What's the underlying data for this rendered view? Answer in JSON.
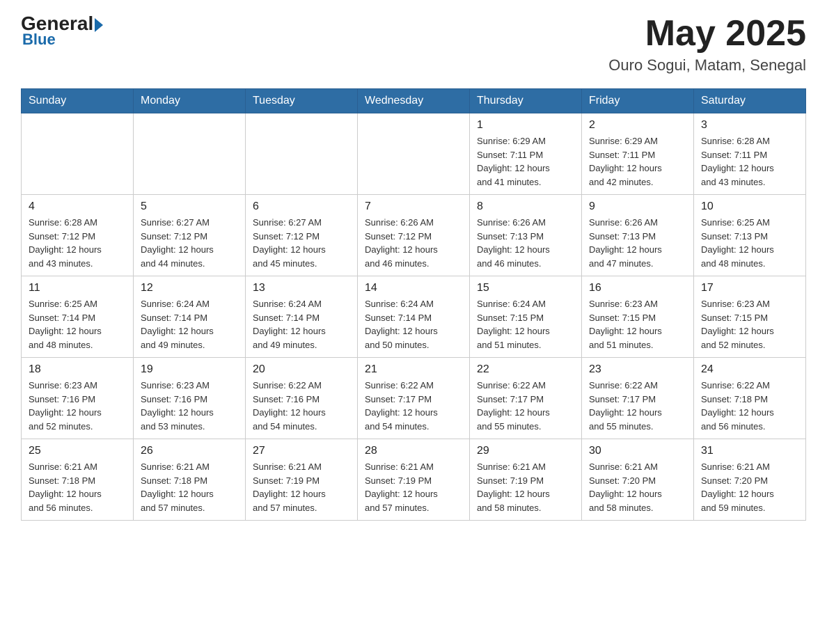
{
  "header": {
    "logo_general": "General",
    "logo_blue": "Blue",
    "month_year": "May 2025",
    "location": "Ouro Sogui, Matam, Senegal"
  },
  "days_of_week": [
    "Sunday",
    "Monday",
    "Tuesday",
    "Wednesday",
    "Thursday",
    "Friday",
    "Saturday"
  ],
  "weeks": [
    [
      {
        "day": "",
        "info": ""
      },
      {
        "day": "",
        "info": ""
      },
      {
        "day": "",
        "info": ""
      },
      {
        "day": "",
        "info": ""
      },
      {
        "day": "1",
        "info": "Sunrise: 6:29 AM\nSunset: 7:11 PM\nDaylight: 12 hours\nand 41 minutes."
      },
      {
        "day": "2",
        "info": "Sunrise: 6:29 AM\nSunset: 7:11 PM\nDaylight: 12 hours\nand 42 minutes."
      },
      {
        "day": "3",
        "info": "Sunrise: 6:28 AM\nSunset: 7:11 PM\nDaylight: 12 hours\nand 43 minutes."
      }
    ],
    [
      {
        "day": "4",
        "info": "Sunrise: 6:28 AM\nSunset: 7:12 PM\nDaylight: 12 hours\nand 43 minutes."
      },
      {
        "day": "5",
        "info": "Sunrise: 6:27 AM\nSunset: 7:12 PM\nDaylight: 12 hours\nand 44 minutes."
      },
      {
        "day": "6",
        "info": "Sunrise: 6:27 AM\nSunset: 7:12 PM\nDaylight: 12 hours\nand 45 minutes."
      },
      {
        "day": "7",
        "info": "Sunrise: 6:26 AM\nSunset: 7:12 PM\nDaylight: 12 hours\nand 46 minutes."
      },
      {
        "day": "8",
        "info": "Sunrise: 6:26 AM\nSunset: 7:13 PM\nDaylight: 12 hours\nand 46 minutes."
      },
      {
        "day": "9",
        "info": "Sunrise: 6:26 AM\nSunset: 7:13 PM\nDaylight: 12 hours\nand 47 minutes."
      },
      {
        "day": "10",
        "info": "Sunrise: 6:25 AM\nSunset: 7:13 PM\nDaylight: 12 hours\nand 48 minutes."
      }
    ],
    [
      {
        "day": "11",
        "info": "Sunrise: 6:25 AM\nSunset: 7:14 PM\nDaylight: 12 hours\nand 48 minutes."
      },
      {
        "day": "12",
        "info": "Sunrise: 6:24 AM\nSunset: 7:14 PM\nDaylight: 12 hours\nand 49 minutes."
      },
      {
        "day": "13",
        "info": "Sunrise: 6:24 AM\nSunset: 7:14 PM\nDaylight: 12 hours\nand 49 minutes."
      },
      {
        "day": "14",
        "info": "Sunrise: 6:24 AM\nSunset: 7:14 PM\nDaylight: 12 hours\nand 50 minutes."
      },
      {
        "day": "15",
        "info": "Sunrise: 6:24 AM\nSunset: 7:15 PM\nDaylight: 12 hours\nand 51 minutes."
      },
      {
        "day": "16",
        "info": "Sunrise: 6:23 AM\nSunset: 7:15 PM\nDaylight: 12 hours\nand 51 minutes."
      },
      {
        "day": "17",
        "info": "Sunrise: 6:23 AM\nSunset: 7:15 PM\nDaylight: 12 hours\nand 52 minutes."
      }
    ],
    [
      {
        "day": "18",
        "info": "Sunrise: 6:23 AM\nSunset: 7:16 PM\nDaylight: 12 hours\nand 52 minutes."
      },
      {
        "day": "19",
        "info": "Sunrise: 6:23 AM\nSunset: 7:16 PM\nDaylight: 12 hours\nand 53 minutes."
      },
      {
        "day": "20",
        "info": "Sunrise: 6:22 AM\nSunset: 7:16 PM\nDaylight: 12 hours\nand 54 minutes."
      },
      {
        "day": "21",
        "info": "Sunrise: 6:22 AM\nSunset: 7:17 PM\nDaylight: 12 hours\nand 54 minutes."
      },
      {
        "day": "22",
        "info": "Sunrise: 6:22 AM\nSunset: 7:17 PM\nDaylight: 12 hours\nand 55 minutes."
      },
      {
        "day": "23",
        "info": "Sunrise: 6:22 AM\nSunset: 7:17 PM\nDaylight: 12 hours\nand 55 minutes."
      },
      {
        "day": "24",
        "info": "Sunrise: 6:22 AM\nSunset: 7:18 PM\nDaylight: 12 hours\nand 56 minutes."
      }
    ],
    [
      {
        "day": "25",
        "info": "Sunrise: 6:21 AM\nSunset: 7:18 PM\nDaylight: 12 hours\nand 56 minutes."
      },
      {
        "day": "26",
        "info": "Sunrise: 6:21 AM\nSunset: 7:18 PM\nDaylight: 12 hours\nand 57 minutes."
      },
      {
        "day": "27",
        "info": "Sunrise: 6:21 AM\nSunset: 7:19 PM\nDaylight: 12 hours\nand 57 minutes."
      },
      {
        "day": "28",
        "info": "Sunrise: 6:21 AM\nSunset: 7:19 PM\nDaylight: 12 hours\nand 57 minutes."
      },
      {
        "day": "29",
        "info": "Sunrise: 6:21 AM\nSunset: 7:19 PM\nDaylight: 12 hours\nand 58 minutes."
      },
      {
        "day": "30",
        "info": "Sunrise: 6:21 AM\nSunset: 7:20 PM\nDaylight: 12 hours\nand 58 minutes."
      },
      {
        "day": "31",
        "info": "Sunrise: 6:21 AM\nSunset: 7:20 PM\nDaylight: 12 hours\nand 59 minutes."
      }
    ]
  ]
}
